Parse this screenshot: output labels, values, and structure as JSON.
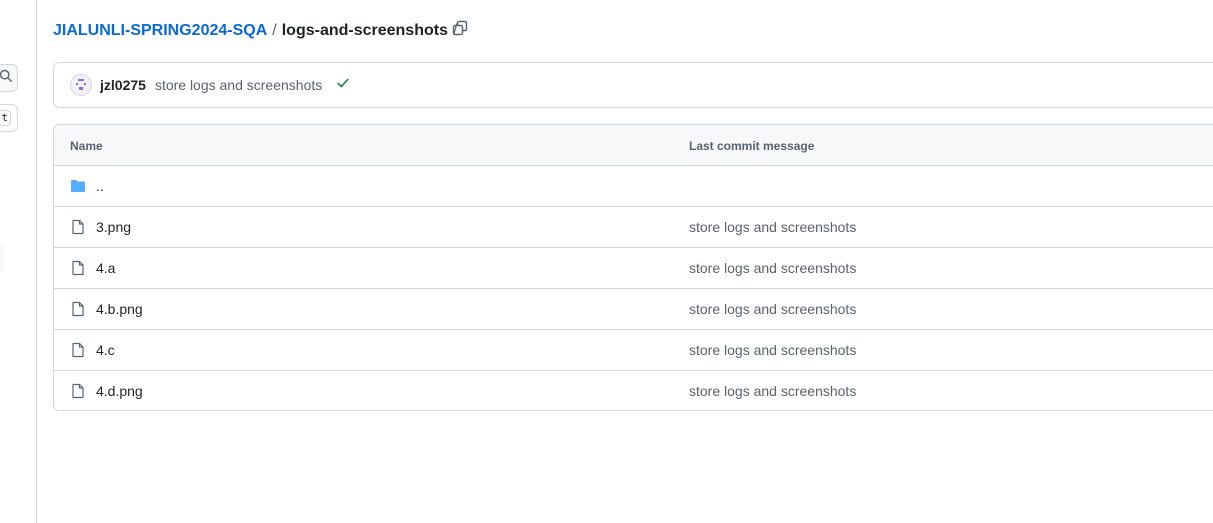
{
  "breadcrumb": {
    "repo": "JIALUNLI-SPRING2024-SQA",
    "separator": "/",
    "folder": "logs-and-screenshots",
    "trailing_separator": "/"
  },
  "left_rail": {
    "shortcut_key": "t"
  },
  "latest_commit": {
    "author": "jzl0275",
    "message": "store logs and screenshots",
    "status": "success"
  },
  "table": {
    "headers": {
      "name": "Name",
      "last_commit_message": "Last commit message"
    },
    "parent_dir": "..",
    "files": [
      {
        "name": "3.png",
        "message": "store logs and screenshots",
        "icon": "file-icon"
      },
      {
        "name": "4.a",
        "message": "store logs and screenshots",
        "icon": "file-icon"
      },
      {
        "name": "4.b.png",
        "message": "store logs and screenshots",
        "icon": "file-icon"
      },
      {
        "name": "4.c",
        "message": "store logs and screenshots",
        "icon": "file-icon"
      },
      {
        "name": "4.d.png",
        "message": "store logs and screenshots",
        "icon": "file-icon"
      }
    ]
  },
  "colors": {
    "link": "#0969da",
    "muted": "#59636e",
    "border": "#d0d7de",
    "folder": "#54aeff",
    "success": "#1a7f37"
  }
}
